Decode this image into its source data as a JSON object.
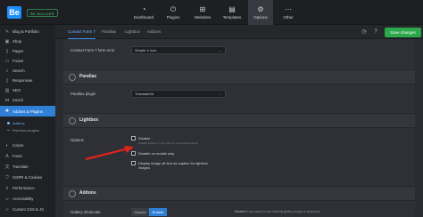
{
  "app": {
    "logo": "Be",
    "badge": "BE BUILDER",
    "nav": [
      {
        "label": "Dashboard",
        "icon": "speedometer-icon"
      },
      {
        "label": "Plugins",
        "icon": "plug-icon"
      },
      {
        "label": "Websites",
        "icon": "grid-icon"
      },
      {
        "label": "Templates",
        "icon": "layers-icon"
      },
      {
        "label": "Options",
        "icon": "gear-icon"
      },
      {
        "label": "Other",
        "icon": "dots-icon"
      }
    ]
  },
  "sidebar": {
    "items": [
      {
        "label": "Blog & Portfolio",
        "icon": "pen-icon"
      },
      {
        "label": "Shop",
        "icon": "cart-icon"
      },
      {
        "label": "Pages",
        "icon": "page-icon"
      },
      {
        "label": "Footer",
        "icon": "footer-icon"
      },
      {
        "label": "Search",
        "icon": "search-icon"
      },
      {
        "label": "Responsive",
        "icon": "phone-icon"
      },
      {
        "label": "SEO",
        "icon": "chart-icon"
      },
      {
        "label": "Social",
        "icon": "share-icon"
      },
      {
        "label": "Addons & Plugins",
        "icon": "puzzle-icon"
      }
    ],
    "sub_items": [
      {
        "label": "Addons"
      },
      {
        "label": "Premium plugins"
      }
    ],
    "items_after": [
      {
        "label": "Colors",
        "icon": "palette-icon"
      },
      {
        "label": "Fonts",
        "icon": "font-icon"
      },
      {
        "label": "Translate",
        "icon": "translate-icon"
      },
      {
        "label": "GDPR & Cookies",
        "icon": "shield-icon"
      },
      {
        "label": "Performance",
        "icon": "bolt-icon"
      },
      {
        "label": "Accessibility",
        "icon": "accessibility-icon"
      },
      {
        "label": "Custom CSS & JS",
        "icon": "code-icon"
      }
    ]
  },
  "tabs": [
    "Contact Form 7",
    "Parallax",
    "Lightbox",
    "Addons"
  ],
  "header": {
    "save_label": "Save changes"
  },
  "contact_form": {
    "label": "Contact Form 7 form error",
    "value": "Simple X icon"
  },
  "parallax": {
    "title": "Parallax",
    "label": "Parallax plugin",
    "value": "Translate3d"
  },
  "lightbox": {
    "title": "Lightbox",
    "options_label": "Options",
    "options": [
      {
        "label": "Disable",
        "hint": "Disable lightbox if you prefer to use external plugin",
        "checked": false
      },
      {
        "label": "Disable on mobile only",
        "checked": false
      },
      {
        "label": "Display image alt text as caption for lightbox images",
        "checked": false
      }
    ]
  },
  "addons": {
    "title": "Addons",
    "gallery_label": "Gallery shortcode",
    "seg_off": "Disable",
    "seg_on": "Enable",
    "note_bold": "Disable",
    "note": " if you want to use external gallery plugin or shortcode"
  },
  "colors": {
    "accent": "#2f80d6",
    "save": "#2aa84a",
    "arrow": "#e0241b"
  }
}
